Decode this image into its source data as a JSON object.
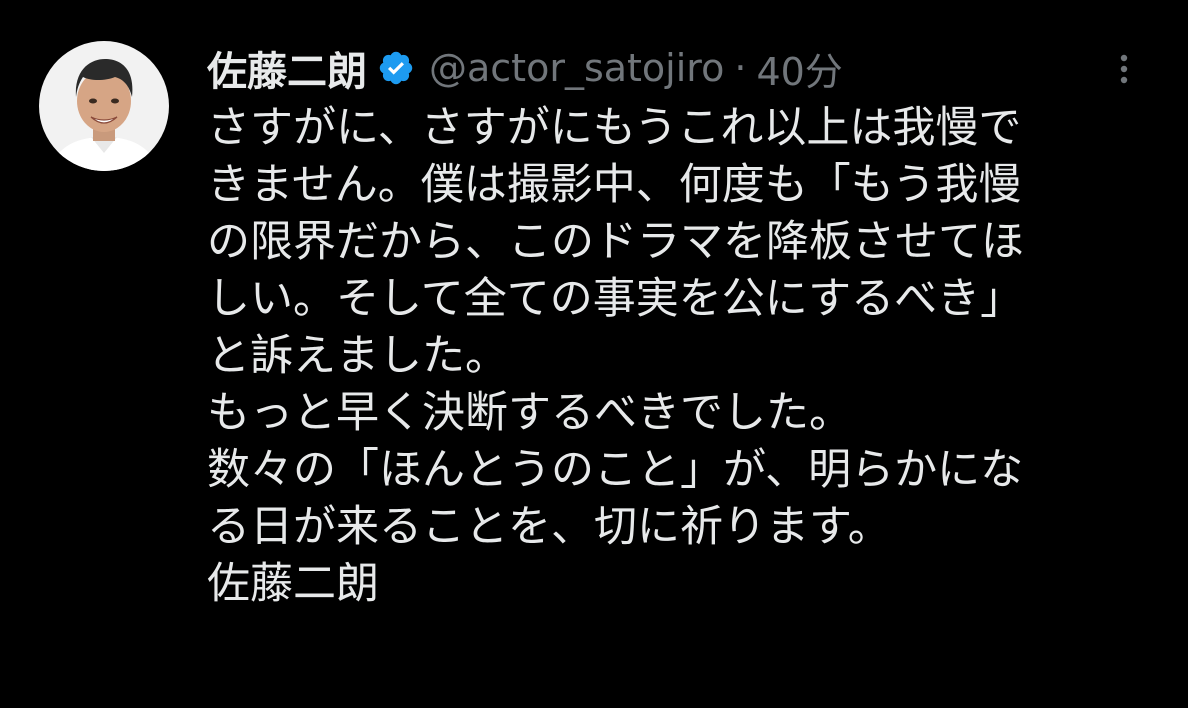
{
  "tweet": {
    "author": {
      "display_name": "佐藤二朗",
      "handle": "@actor_satojiro",
      "verified_icon": "verified-badge-icon"
    },
    "separator": "·",
    "timestamp": "40分",
    "more_icon": "more-vertical-icon",
    "body_lines": [
      "さすがに、さすがにもうこれ以上は我慢で",
      "きません。僕は撮影中、何度も「もう我慢",
      "の限界だから、このドラマを降板させてほ",
      "しい。そして全ての事実を公にするべき」",
      "と訴えました。",
      "もっと早く決断するべきでした。",
      "数々の「ほんとうのこと」が、明らかにな",
      "る日が来ることを、切に祈ります。",
      "佐藤二朗"
    ]
  },
  "colors": {
    "background": "#000000",
    "primary_text": "#e7e9ea",
    "secondary_text": "#71767b",
    "verified_blue": "#1d9bf0"
  }
}
